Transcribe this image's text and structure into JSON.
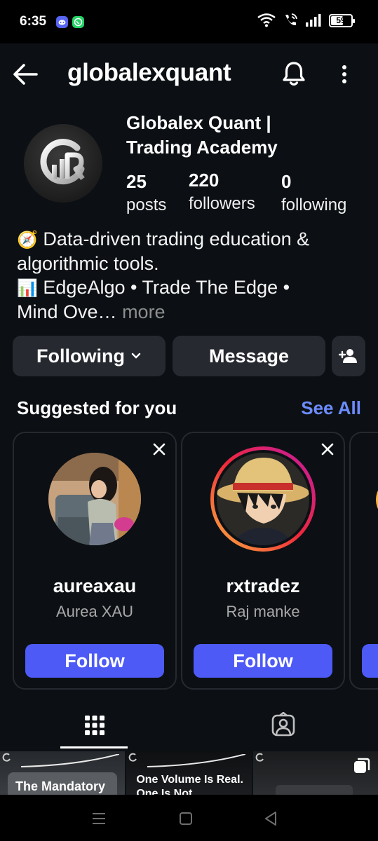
{
  "status_bar": {
    "time": "6:35",
    "battery": "59",
    "icons": [
      "discord-icon",
      "whatsapp-icon",
      "wifi-icon",
      "wifi-call-icon",
      "signal-icon",
      "battery-icon"
    ]
  },
  "header": {
    "username": "globalexquant",
    "icons": [
      "back-arrow-icon",
      "bell-icon",
      "more-vertical-icon"
    ]
  },
  "profile": {
    "full_name_line1": "Globalex Quant |",
    "full_name_line2": "Trading Academy",
    "stats": {
      "posts": {
        "count": "25",
        "label": "posts"
      },
      "followers": {
        "count": "220",
        "label": "followers"
      },
      "following": {
        "count": "0",
        "label": "following"
      }
    },
    "bio_line1_emoji": "🧭",
    "bio_line1_text": "Data-driven trading education &",
    "bio_line2": "algorithmic tools.",
    "bio_line3_emoji": "📊",
    "bio_line3_text": "EdgeAlgo • Trade The Edge •",
    "bio_line4_text": "Mind Ove…",
    "bio_more": "more"
  },
  "actions": {
    "following_label": "Following",
    "message_label": "Message"
  },
  "suggested": {
    "title": "Suggested for you",
    "see_all": "See All",
    "cards": [
      {
        "handle": "aureaxau",
        "name": "Aurea XAU",
        "follow_label": "Follow"
      },
      {
        "handle": "rxtradez",
        "name": "Raj manke",
        "follow_label": "Follow"
      }
    ]
  },
  "grid_posts": [
    {
      "text": "The Mandatory"
    },
    {
      "text_line1": "One Volume Is Real.",
      "text_line2": "One Is Not"
    },
    {
      "text": ""
    }
  ],
  "colors": {
    "background": "#0c1014",
    "button_bg": "#262a30",
    "follow_blue": "#4d5af6",
    "link_blue": "#6c8cff",
    "secondary_text": "#a8a8a8"
  }
}
